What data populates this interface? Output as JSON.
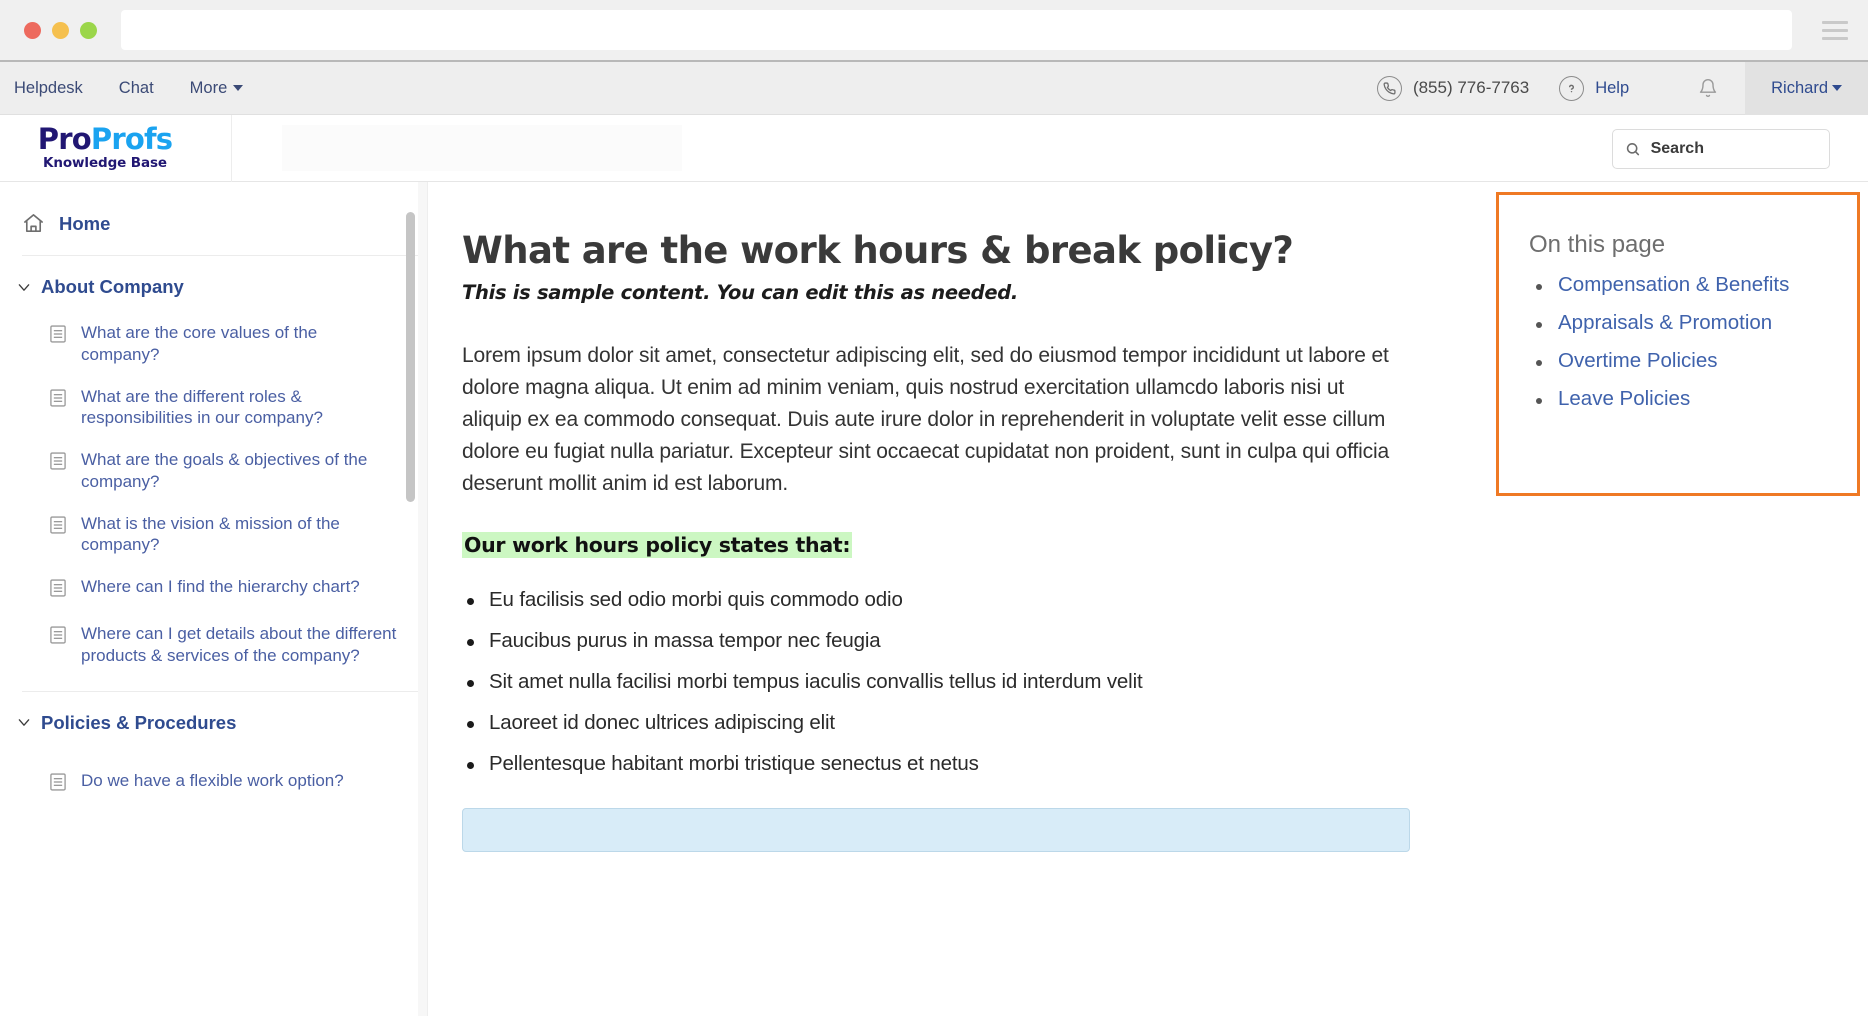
{
  "browser": {
    "url_value": "",
    "url_placeholder": ""
  },
  "topnav": {
    "links": [
      {
        "label": "Helpdesk"
      },
      {
        "label": "Chat"
      },
      {
        "label": "More"
      }
    ],
    "phone": "(855) 776-7763",
    "help_label": "Help",
    "user_name": "Richard"
  },
  "brand": {
    "logo_pro": "Pro",
    "logo_profs": "Profs",
    "logo_sub": "Knowledge Base",
    "search_placeholder": "Search",
    "search_value": ""
  },
  "sidebar": {
    "home_label": "Home",
    "sections": [
      {
        "label": "About Company",
        "items": [
          {
            "label": "What are the core values of the company?"
          },
          {
            "label": "What are the different roles & responsibilities in our company?"
          },
          {
            "label": "What are the goals & objectives of the company?"
          },
          {
            "label": "What is the vision & mission of the company?"
          },
          {
            "label": "Where can I find the hierarchy chart?"
          },
          {
            "label": "Where can I get details about the different products & services of the company?"
          }
        ]
      },
      {
        "label": "Policies & Procedures",
        "items": [
          {
            "label": "Do we have a flexible work option?"
          }
        ]
      }
    ]
  },
  "article": {
    "title": "What are the work hours & break policy?",
    "subtitle": "This is sample content. You can edit this as needed.",
    "paragraph": "Lorem ipsum dolor sit amet, consectetur adipiscing elit, sed do eiusmod tempor incididunt ut labore et dolore magna aliqua. Ut enim ad minim veniam, quis nostrud exercitation ullamcdo laboris nisi ut aliquip ex ea commodo consequat. Duis aute irure dolor in reprehenderit in voluptate velit esse cillum dolore eu fugiat nulla pariatur. Excepteur sint occaecat cupidatat non proident, sunt in culpa qui officia deserunt mollit anim id est laborum.",
    "section_heading": "Our work hours policy states that:",
    "bullets": [
      {
        "text": "Eu facilisis sed odio morbi quis commodo odio"
      },
      {
        "text": "Faucibus purus in massa tempor nec feugia"
      },
      {
        "text": "Sit amet nulla facilisi morbi tempus iaculis convallis tellus id interdum velit"
      },
      {
        "text": "Laoreet id donec ultrices adipiscing elit"
      },
      {
        "text": "Pellentesque habitant morbi tristique senectus et netus"
      }
    ]
  },
  "toc": {
    "title": "On this page",
    "items": [
      {
        "label": "Compensation & Benefits"
      },
      {
        "label": "Appraisals & Promotion"
      },
      {
        "label": "Overtime Policies"
      },
      {
        "label": "Leave Policies"
      }
    ],
    "highlight_color": "#ef7924"
  }
}
